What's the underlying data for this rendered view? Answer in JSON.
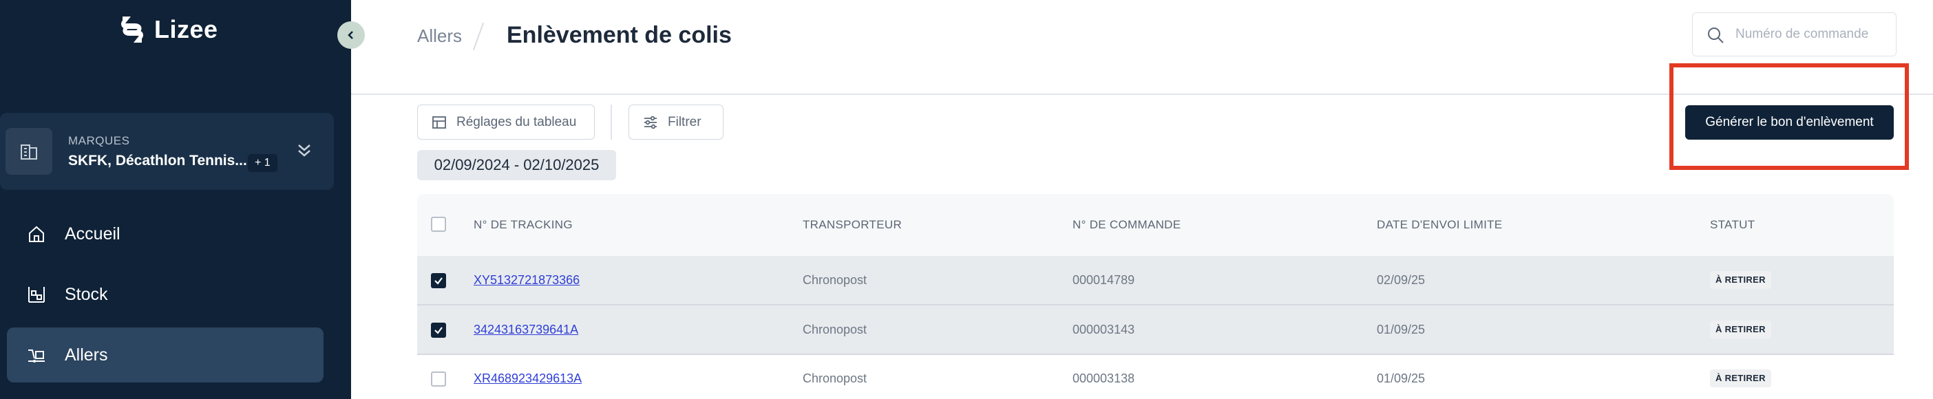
{
  "app": {
    "name": "Lizee"
  },
  "brand": {
    "label": "MARQUES",
    "name": "SKFK, Décathlon Tennis...",
    "extra_count": "+ 1"
  },
  "nav": {
    "items": [
      {
        "label": "Accueil",
        "icon": "home-icon"
      },
      {
        "label": "Stock",
        "icon": "stock-icon"
      },
      {
        "label": "Allers",
        "icon": "shipping-icon",
        "active": true
      }
    ]
  },
  "header": {
    "breadcrumb_root": "Allers",
    "title": "Enlèvement de colis",
    "search_placeholder": "Numéro de commande"
  },
  "toolbar": {
    "settings_label": "Réglages du tableau",
    "filter_label": "Filtrer",
    "date_range": "02/09/2024 - 02/10/2025",
    "generate_label": "Générer le bon d'enlèvement"
  },
  "table": {
    "columns": [
      "N° DE TRACKING",
      "TRANSPORTEUR",
      "N° DE COMMANDE",
      "DATE D'ENVOI LIMITE",
      "STATUT"
    ],
    "rows": [
      {
        "checked": true,
        "tracking": "XY5132721873366",
        "carrier": "Chronopost",
        "order": "000014789",
        "date": "02/09/25",
        "status": "À RETIRER"
      },
      {
        "checked": true,
        "tracking": "34243163739641A",
        "carrier": "Chronopost",
        "order": "000003143",
        "date": "01/09/25",
        "status": "À RETIRER"
      },
      {
        "checked": false,
        "tracking": "XR468923429613A",
        "carrier": "Chronopost",
        "order": "000003138",
        "date": "01/09/25",
        "status": "À RETIRER"
      }
    ]
  },
  "colors": {
    "sidebar_bg": "#0f2237",
    "primary": "#0f2237",
    "highlight": "#e23a23",
    "link": "#2f3fd6"
  }
}
